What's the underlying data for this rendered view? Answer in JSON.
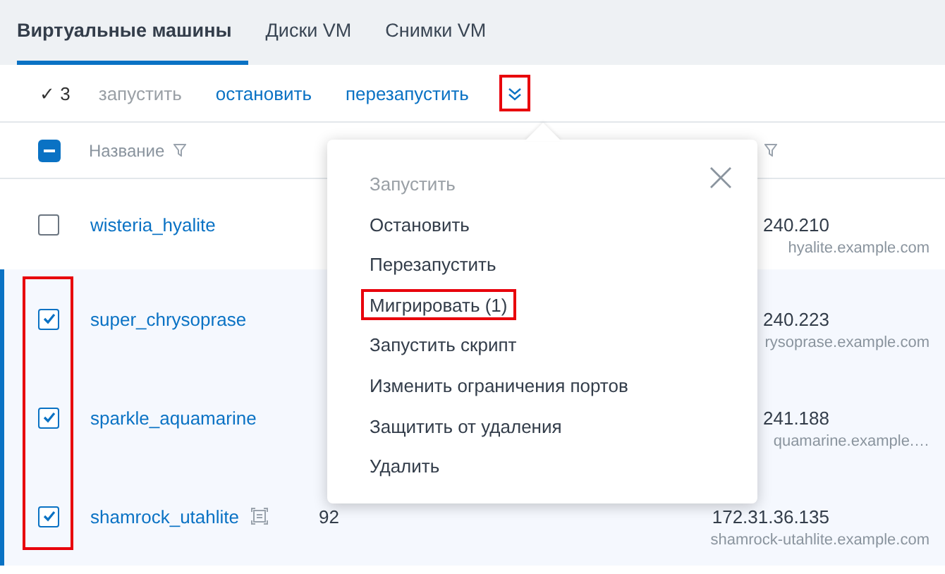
{
  "tabs": [
    {
      "label": "Виртуальные машины",
      "selected": true
    },
    {
      "label": "Диски VM",
      "selected": false
    },
    {
      "label": "Снимки VM",
      "selected": false
    }
  ],
  "toolbar": {
    "selected_mark": "✓",
    "selected_count": "3",
    "actions": [
      {
        "label": "запустить",
        "disabled": true
      },
      {
        "label": "остановить",
        "disabled": false
      },
      {
        "label": "перезапустить",
        "disabled": false
      }
    ],
    "more_highlighted": true
  },
  "table": {
    "header_checkbox_partial": true,
    "columns": [
      {
        "label": "Название"
      }
    ],
    "checkbox_column_highlighted": true,
    "rows": [
      {
        "selected": false,
        "name": "wisteria_hyalite",
        "column_3": "",
        "ip": "240.210",
        "host": "hyalite.example.com",
        "console": false
      },
      {
        "selected": true,
        "name": "super_chrysoprase",
        "column_3": "",
        "ip": "240.223",
        "host": "rysoprase.example.com",
        "console": false
      },
      {
        "selected": true,
        "name": "sparkle_aquamarine",
        "column_3": "",
        "ip": "241.188",
        "host": "quamarine.example.…",
        "console": false
      },
      {
        "selected": true,
        "name": "shamrock_utahlite",
        "column_3": "92",
        "ip": "172.31.36.135",
        "host": "shamrock-utahlite.example.com",
        "console": true
      }
    ]
  },
  "menu": {
    "items": [
      {
        "label": "Запустить",
        "disabled": true,
        "highlighted": false
      },
      {
        "label": "Остановить",
        "disabled": false,
        "highlighted": false
      },
      {
        "label": "Перезапустить",
        "disabled": false,
        "highlighted": false
      },
      {
        "label": "Мигрировать (1)",
        "disabled": false,
        "highlighted": true
      },
      {
        "label": "Запустить скрипт",
        "disabled": false,
        "highlighted": false
      },
      {
        "label": "Изменить ограничения портов",
        "disabled": false,
        "highlighted": false
      },
      {
        "label": "Защитить от удаления",
        "disabled": false,
        "highlighted": false
      },
      {
        "label": "Удалить",
        "disabled": false,
        "highlighted": false
      }
    ]
  }
}
